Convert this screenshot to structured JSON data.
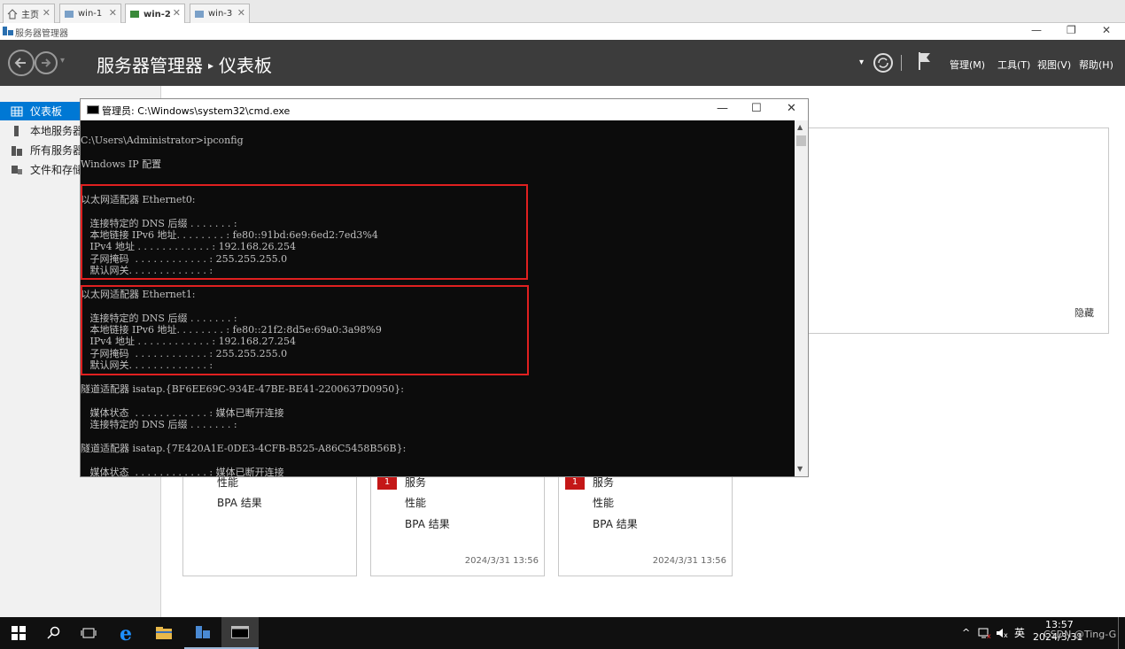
{
  "vm_tabs": [
    {
      "label": "主页"
    },
    {
      "label": "win-1"
    },
    {
      "label": "win-2"
    },
    {
      "label": "win-3"
    }
  ],
  "app": {
    "window_title": "服务器管理器",
    "window_controls": {
      "min": "—",
      "max": "❐",
      "close": "✕"
    }
  },
  "header": {
    "breadcrumb_root": "服务器管理器",
    "breadcrumb_sep": "▸",
    "breadcrumb_page": "仪表板",
    "dropdown": "▾",
    "menu": [
      "管理(M)",
      "工具(T)",
      "视图(V)",
      "帮助(H)"
    ]
  },
  "sidebar": {
    "items": [
      {
        "label": "仪表板",
        "selected": true
      },
      {
        "label": "本地服务器"
      },
      {
        "label": "所有服务器"
      },
      {
        "label": "文件和存储"
      }
    ]
  },
  "panel": {
    "hide_label": "隐藏"
  },
  "tiles": [
    {
      "rows": [
        "性能",
        "BPA 结果"
      ],
      "timestamp": ""
    },
    {
      "badge": "1",
      "rows": [
        "服务",
        "性能",
        "BPA 结果"
      ],
      "timestamp": "2024/3/31 13:56"
    },
    {
      "badge": "1",
      "rows": [
        "服务",
        "性能",
        "BPA 结果"
      ],
      "timestamp": "2024/3/31 13:56"
    }
  ],
  "cmd": {
    "title": "管理员: C:\\Windows\\system32\\cmd.exe",
    "controls": {
      "min": "—",
      "max": "☐",
      "close": "✕"
    },
    "lines": [
      "C:\\Users\\Administrator>ipconfig",
      "Windows IP 配置",
      "以太网适配器 Ethernet0:",
      "   连接特定的 DNS 后缀 . . . . . . . :",
      "   本地链接 IPv6 地址. . . . . . . . : fe80::91bd:6e9:6ed2:7ed3%4",
      "   IPv4 地址 . . . . . . . . . . . . : 192.168.26.254",
      "   子网掩码  . . . . . . . . . . . . : 255.255.255.0",
      "   默认网关. . . . . . . . . . . . . :",
      "以太网适配器 Ethernet1:",
      "   连接特定的 DNS 后缀 . . . . . . . :",
      "   本地链接 IPv6 地址. . . . . . . . : fe80::21f2:8d5e:69a0:3a98%9",
      "   IPv4 地址 . . . . . . . . . . . . : 192.168.27.254",
      "   子网掩码  . . . . . . . . . . . . : 255.255.255.0",
      "   默认网关. . . . . . . . . . . . . :",
      "隧道适配器 isatap.{BF6EE69C-934E-47BE-BE41-2200637D0950}:",
      "   媒体状态  . . . . . . . . . . . . : 媒体已断开连接",
      "   连接特定的 DNS 后缀 . . . . . . . :",
      "隧道适配器 isatap.{7E420A1E-0DE3-4CFB-B525-A86C5458B56B}:",
      "   媒体状态  . . . . . . . . . . . . : 媒体已断开连接"
    ]
  },
  "taskbar": {
    "ime": "英",
    "time": "13:57",
    "date": "2024/3/31",
    "watermark": "CSDN @Ting-G"
  },
  "colors": {
    "accent": "#0078d4",
    "highlight": "#e02020",
    "badge": "#c41717"
  }
}
